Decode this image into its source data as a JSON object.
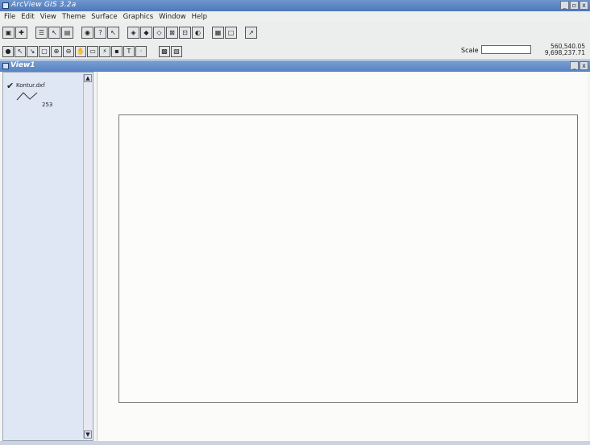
{
  "app": {
    "title": "ArcView GIS 3.2a",
    "window_buttons": [
      "_",
      "▫",
      "x"
    ]
  },
  "menu": [
    "File",
    "Edit",
    "View",
    "Theme",
    "Surface",
    "Graphics",
    "Window",
    "Help"
  ],
  "toolbar1": {
    "groups": [
      [
        "save",
        "add-theme"
      ],
      [
        "theme-properties",
        "edit-legend",
        "open-table"
      ],
      [
        "find",
        "query-builder",
        "select-features"
      ],
      [
        "zoom-full",
        "zoom-active",
        "zoom-selected",
        "zoom-in",
        "zoom-out",
        "zoom-previous"
      ],
      [
        "layout",
        "drawing"
      ],
      [
        "help"
      ]
    ]
  },
  "toolbar2": {
    "tools": [
      "identify",
      "pointer",
      "select-vertex",
      "select-feature",
      "zoom-in",
      "zoom-out",
      "pan",
      "measure",
      "hotlink",
      "label",
      "text",
      "draw-point"
    ],
    "extra": [
      "snap",
      "draw-polygon"
    ]
  },
  "scale": {
    "label": "Scale 1:",
    "value": ""
  },
  "coords": {
    "x": "560,540.05",
    "y": "9,698,237.71"
  },
  "view": {
    "title": "View1",
    "window_buttons": [
      "_",
      "x"
    ]
  },
  "toc": {
    "themes": [
      {
        "name": "Kontur.dxf",
        "legend_value": "253"
      }
    ]
  }
}
